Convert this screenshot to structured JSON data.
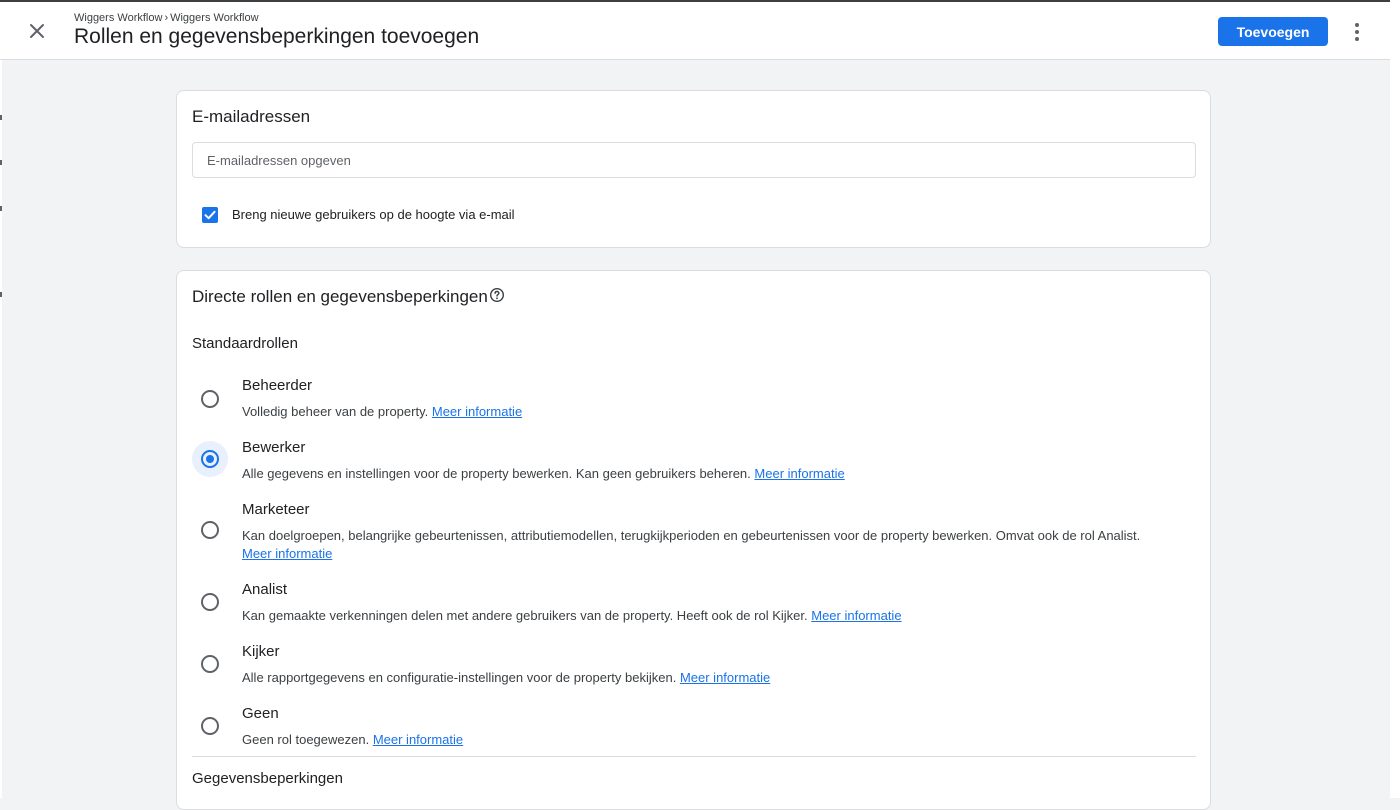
{
  "header": {
    "breadcrumb": [
      "Wiggers Workflow",
      "Wiggers Workflow"
    ],
    "breadcrumb_separator": "›",
    "title": "Rollen en gegevensbeperkingen toevoegen",
    "add_label": "Toevoegen"
  },
  "email_section": {
    "title": "E-mailadressen",
    "input_placeholder": "E-mailadressen opgeven",
    "input_value": "",
    "notify_label": "Breng nieuwe gebruikers op de hoogte via e-mail",
    "notify_checked": true
  },
  "roles_section": {
    "title": "Directe rollen en gegevensbeperkingen",
    "standard_roles_label": "Standaardrollen",
    "link_label": "Meer informatie",
    "selected": "Bewerker",
    "roles": [
      {
        "name": "Beheerder",
        "description": "Volledig beheer van de property."
      },
      {
        "name": "Bewerker",
        "description": "Alle gegevens en instellingen voor de property bewerken. Kan geen gebruikers beheren."
      },
      {
        "name": "Marketeer",
        "description": "Kan doelgroepen, belangrijke gebeurtenissen, attributiemodellen, terugkijkperioden en gebeurtenissen voor de property bewerken. Omvat ook de rol Analist."
      },
      {
        "name": "Analist",
        "description": "Kan gemaakte verkenningen delen met andere gebruikers van de property. Heeft ook de rol Kijker."
      },
      {
        "name": "Kijker",
        "description": "Alle rapportgegevens en configuratie-instellingen voor de property bekijken."
      },
      {
        "name": "Geen",
        "description": "Geen rol toegewezen."
      }
    ],
    "data_restrictions_label": "Gegevensbeperkingen"
  },
  "colors": {
    "accent": "#1a73e8",
    "page_background": "#f1f3f4",
    "selected_radio_halo": "#e8f0fe"
  },
  "icons": {
    "close": "close-icon",
    "more": "more-vert-icon",
    "help": "help-circle-icon",
    "check": "check-icon"
  }
}
